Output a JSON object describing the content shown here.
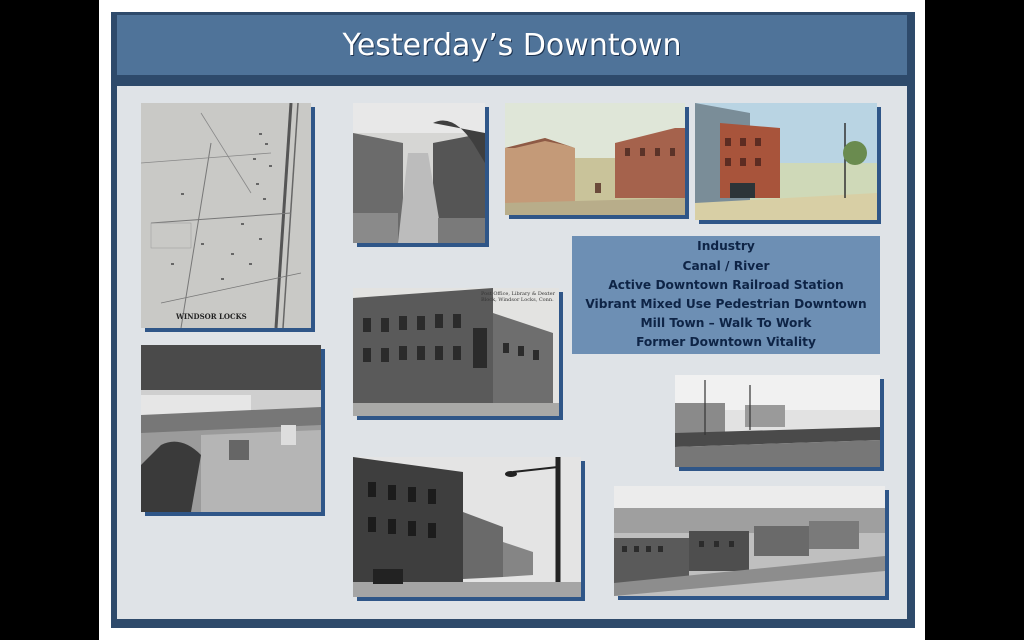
{
  "title": "Yesterday’s Downtown",
  "bullets": [
    "Industry",
    "Canal / River",
    "Active Downtown Railroad Station",
    "Vibrant Mixed Use Pedestrian Downtown",
    "Mill Town – Walk To Work",
    "Former Downtown Vitality"
  ],
  "map_caption": "WINDSOR LOCKS",
  "building_caption": "Post Office, Library & Dexter Block, Windsor Locks, Conn.",
  "colors": {
    "frame": "#2e4a6b",
    "title_bar": "#4f7399",
    "content_bg": "#dfe3e7",
    "text_box": "#6d8fb4",
    "text_box_text": "#0e2446",
    "photo_shadow": "#2f5688"
  }
}
